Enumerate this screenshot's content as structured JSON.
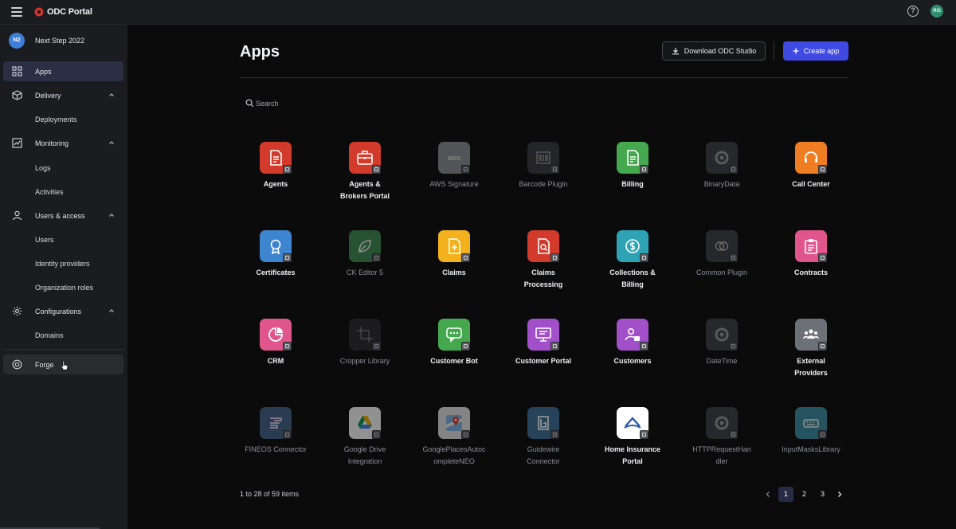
{
  "topbar": {
    "brand": "ODC Portal",
    "user_initials": "RG",
    "help_glyph": "?"
  },
  "sidebar": {
    "org": {
      "initials": "N2",
      "name": "Next Step 2022"
    },
    "items": [
      {
        "label": "Apps",
        "icon": "grid-icon"
      },
      {
        "label": "Delivery",
        "icon": "box-icon"
      },
      {
        "label": "Deployments"
      },
      {
        "label": "Monitoring",
        "icon": "chart-icon"
      },
      {
        "label": "Logs"
      },
      {
        "label": "Activities"
      },
      {
        "label": "Users & access",
        "icon": "user-icon"
      },
      {
        "label": "Users"
      },
      {
        "label": "Identity providers"
      },
      {
        "label": "Organization roles"
      },
      {
        "label": "Configurations",
        "icon": "gear-icon"
      },
      {
        "label": "Domains"
      },
      {
        "label": "Forge",
        "icon": "forge-icon"
      }
    ]
  },
  "main": {
    "title": "Apps",
    "download_label": "Download ODC Studio",
    "create_label": "Create app",
    "search_placeholder": "Search"
  },
  "apps": [
    {
      "name": "Agents",
      "color": "#d23b2b"
    },
    {
      "name": "Agents & Brokers Portal",
      "color": "#d23b2b"
    },
    {
      "name": "AWS Signature",
      "color": "#8e9095"
    },
    {
      "name": "Barcode Plugin",
      "color": "#3a3c41"
    },
    {
      "name": "Billing",
      "color": "#45a84f"
    },
    {
      "name": "BinaryData",
      "color": "#3f4146"
    },
    {
      "name": "Call Center",
      "color": "#ef7d22"
    },
    {
      "name": "Certificates",
      "color": "#3d85cf"
    },
    {
      "name": "CK Editor 5",
      "color": "#3f8f52"
    },
    {
      "name": "Claims",
      "color": "#f2b11d"
    },
    {
      "name": "Claims Processing",
      "color": "#d23b2b"
    },
    {
      "name": "Collections & Billing",
      "color": "#2fa3b6"
    },
    {
      "name": "Common Plugin",
      "color": "#3f4146"
    },
    {
      "name": "Contracts",
      "color": "#e0558b"
    },
    {
      "name": "CRM",
      "color": "#e0558b"
    },
    {
      "name": "Cropper Library",
      "color": "#2a2b2f"
    },
    {
      "name": "Customer Bot",
      "color": "#45a84f"
    },
    {
      "name": "Customer Portal",
      "color": "#a150c9"
    },
    {
      "name": "Customers",
      "color": "#a150c9"
    },
    {
      "name": "DateTime",
      "color": "#3f4146"
    },
    {
      "name": "External Providers",
      "color": "#6d7076"
    },
    {
      "name": "FINEOS Connector",
      "color": "#44648a"
    },
    {
      "name": "Google Drive Integration",
      "color": "#ffffff"
    },
    {
      "name": "GooglePlacesAutocompleteNEO",
      "color": "#e8e8e8"
    },
    {
      "name": "Guidewire Connector",
      "color": "#3f6f9c"
    },
    {
      "name": "Home Insurance Portal",
      "color": "#ffffff"
    },
    {
      "name": "HTTPRequestHandler",
      "color": "#3f4146"
    },
    {
      "name": "InputMasksLibrary",
      "color": "#3b8fa6"
    }
  ],
  "pagination": {
    "summary": "1 to 28 of 59 items",
    "pages": [
      "1",
      "2",
      "3"
    ],
    "current": "1"
  }
}
